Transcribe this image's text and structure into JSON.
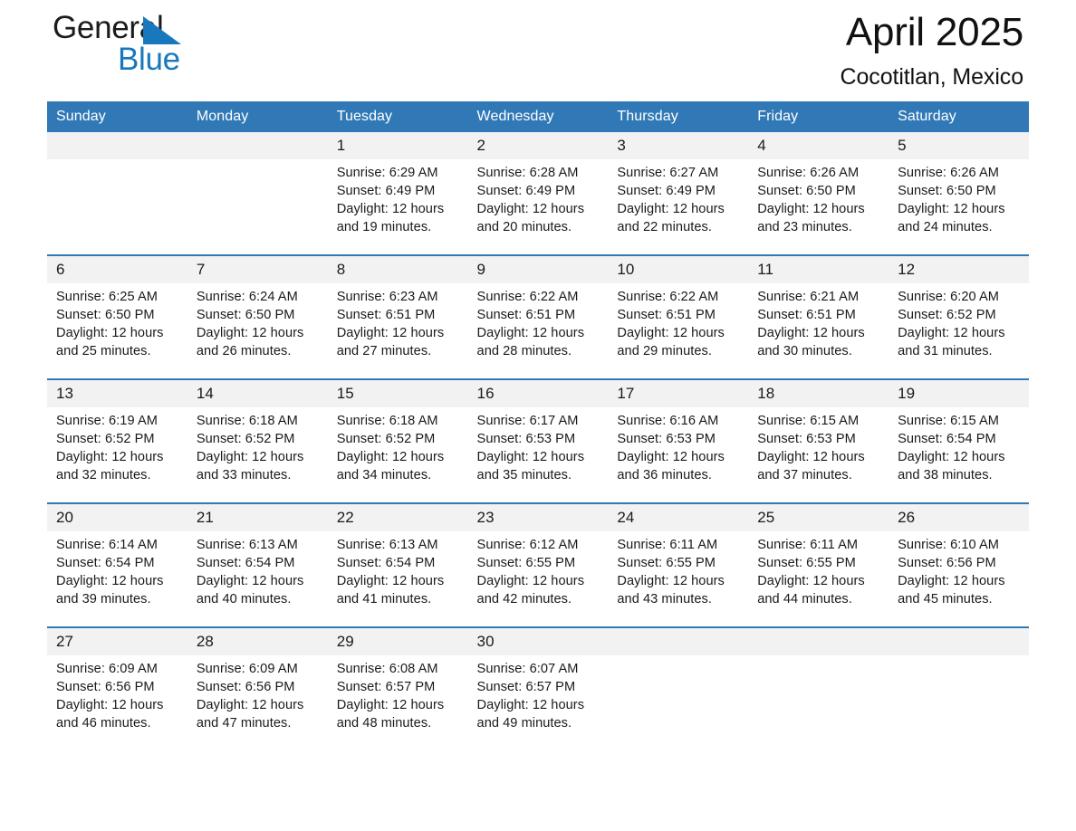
{
  "logo": {
    "line1": "General",
    "line2": "Blue",
    "triangle_color": "#1878be"
  },
  "header": {
    "title": "April 2025",
    "subtitle": "Cocotitlan, Mexico"
  },
  "colors": {
    "header_blue": "#3179b6",
    "row_band": "#f2f2f2",
    "text": "#1a1a1a"
  },
  "weekday_headers": [
    "Sunday",
    "Monday",
    "Tuesday",
    "Wednesday",
    "Thursday",
    "Friday",
    "Saturday"
  ],
  "weeks": [
    {
      "days": [
        {
          "num": "",
          "l1": "",
          "l2": "",
          "l3": "",
          "l4": ""
        },
        {
          "num": "",
          "l1": "",
          "l2": "",
          "l3": "",
          "l4": ""
        },
        {
          "num": "1",
          "l1": "Sunrise: 6:29 AM",
          "l2": "Sunset: 6:49 PM",
          "l3": "Daylight: 12 hours",
          "l4": "and 19 minutes."
        },
        {
          "num": "2",
          "l1": "Sunrise: 6:28 AM",
          "l2": "Sunset: 6:49 PM",
          "l3": "Daylight: 12 hours",
          "l4": "and 20 minutes."
        },
        {
          "num": "3",
          "l1": "Sunrise: 6:27 AM",
          "l2": "Sunset: 6:49 PM",
          "l3": "Daylight: 12 hours",
          "l4": "and 22 minutes."
        },
        {
          "num": "4",
          "l1": "Sunrise: 6:26 AM",
          "l2": "Sunset: 6:50 PM",
          "l3": "Daylight: 12 hours",
          "l4": "and 23 minutes."
        },
        {
          "num": "5",
          "l1": "Sunrise: 6:26 AM",
          "l2": "Sunset: 6:50 PM",
          "l3": "Daylight: 12 hours",
          "l4": "and 24 minutes."
        }
      ]
    },
    {
      "days": [
        {
          "num": "6",
          "l1": "Sunrise: 6:25 AM",
          "l2": "Sunset: 6:50 PM",
          "l3": "Daylight: 12 hours",
          "l4": "and 25 minutes."
        },
        {
          "num": "7",
          "l1": "Sunrise: 6:24 AM",
          "l2": "Sunset: 6:50 PM",
          "l3": "Daylight: 12 hours",
          "l4": "and 26 minutes."
        },
        {
          "num": "8",
          "l1": "Sunrise: 6:23 AM",
          "l2": "Sunset: 6:51 PM",
          "l3": "Daylight: 12 hours",
          "l4": "and 27 minutes."
        },
        {
          "num": "9",
          "l1": "Sunrise: 6:22 AM",
          "l2": "Sunset: 6:51 PM",
          "l3": "Daylight: 12 hours",
          "l4": "and 28 minutes."
        },
        {
          "num": "10",
          "l1": "Sunrise: 6:22 AM",
          "l2": "Sunset: 6:51 PM",
          "l3": "Daylight: 12 hours",
          "l4": "and 29 minutes."
        },
        {
          "num": "11",
          "l1": "Sunrise: 6:21 AM",
          "l2": "Sunset: 6:51 PM",
          "l3": "Daylight: 12 hours",
          "l4": "and 30 minutes."
        },
        {
          "num": "12",
          "l1": "Sunrise: 6:20 AM",
          "l2": "Sunset: 6:52 PM",
          "l3": "Daylight: 12 hours",
          "l4": "and 31 minutes."
        }
      ]
    },
    {
      "days": [
        {
          "num": "13",
          "l1": "Sunrise: 6:19 AM",
          "l2": "Sunset: 6:52 PM",
          "l3": "Daylight: 12 hours",
          "l4": "and 32 minutes."
        },
        {
          "num": "14",
          "l1": "Sunrise: 6:18 AM",
          "l2": "Sunset: 6:52 PM",
          "l3": "Daylight: 12 hours",
          "l4": "and 33 minutes."
        },
        {
          "num": "15",
          "l1": "Sunrise: 6:18 AM",
          "l2": "Sunset: 6:52 PM",
          "l3": "Daylight: 12 hours",
          "l4": "and 34 minutes."
        },
        {
          "num": "16",
          "l1": "Sunrise: 6:17 AM",
          "l2": "Sunset: 6:53 PM",
          "l3": "Daylight: 12 hours",
          "l4": "and 35 minutes."
        },
        {
          "num": "17",
          "l1": "Sunrise: 6:16 AM",
          "l2": "Sunset: 6:53 PM",
          "l3": "Daylight: 12 hours",
          "l4": "and 36 minutes."
        },
        {
          "num": "18",
          "l1": "Sunrise: 6:15 AM",
          "l2": "Sunset: 6:53 PM",
          "l3": "Daylight: 12 hours",
          "l4": "and 37 minutes."
        },
        {
          "num": "19",
          "l1": "Sunrise: 6:15 AM",
          "l2": "Sunset: 6:54 PM",
          "l3": "Daylight: 12 hours",
          "l4": "and 38 minutes."
        }
      ]
    },
    {
      "days": [
        {
          "num": "20",
          "l1": "Sunrise: 6:14 AM",
          "l2": "Sunset: 6:54 PM",
          "l3": "Daylight: 12 hours",
          "l4": "and 39 minutes."
        },
        {
          "num": "21",
          "l1": "Sunrise: 6:13 AM",
          "l2": "Sunset: 6:54 PM",
          "l3": "Daylight: 12 hours",
          "l4": "and 40 minutes."
        },
        {
          "num": "22",
          "l1": "Sunrise: 6:13 AM",
          "l2": "Sunset: 6:54 PM",
          "l3": "Daylight: 12 hours",
          "l4": "and 41 minutes."
        },
        {
          "num": "23",
          "l1": "Sunrise: 6:12 AM",
          "l2": "Sunset: 6:55 PM",
          "l3": "Daylight: 12 hours",
          "l4": "and 42 minutes."
        },
        {
          "num": "24",
          "l1": "Sunrise: 6:11 AM",
          "l2": "Sunset: 6:55 PM",
          "l3": "Daylight: 12 hours",
          "l4": "and 43 minutes."
        },
        {
          "num": "25",
          "l1": "Sunrise: 6:11 AM",
          "l2": "Sunset: 6:55 PM",
          "l3": "Daylight: 12 hours",
          "l4": "and 44 minutes."
        },
        {
          "num": "26",
          "l1": "Sunrise: 6:10 AM",
          "l2": "Sunset: 6:56 PM",
          "l3": "Daylight: 12 hours",
          "l4": "and 45 minutes."
        }
      ]
    },
    {
      "days": [
        {
          "num": "27",
          "l1": "Sunrise: 6:09 AM",
          "l2": "Sunset: 6:56 PM",
          "l3": "Daylight: 12 hours",
          "l4": "and 46 minutes."
        },
        {
          "num": "28",
          "l1": "Sunrise: 6:09 AM",
          "l2": "Sunset: 6:56 PM",
          "l3": "Daylight: 12 hours",
          "l4": "and 47 minutes."
        },
        {
          "num": "29",
          "l1": "Sunrise: 6:08 AM",
          "l2": "Sunset: 6:57 PM",
          "l3": "Daylight: 12 hours",
          "l4": "and 48 minutes."
        },
        {
          "num": "30",
          "l1": "Sunrise: 6:07 AM",
          "l2": "Sunset: 6:57 PM",
          "l3": "Daylight: 12 hours",
          "l4": "and 49 minutes."
        },
        {
          "num": "",
          "l1": "",
          "l2": "",
          "l3": "",
          "l4": ""
        },
        {
          "num": "",
          "l1": "",
          "l2": "",
          "l3": "",
          "l4": ""
        },
        {
          "num": "",
          "l1": "",
          "l2": "",
          "l3": "",
          "l4": ""
        }
      ]
    }
  ]
}
